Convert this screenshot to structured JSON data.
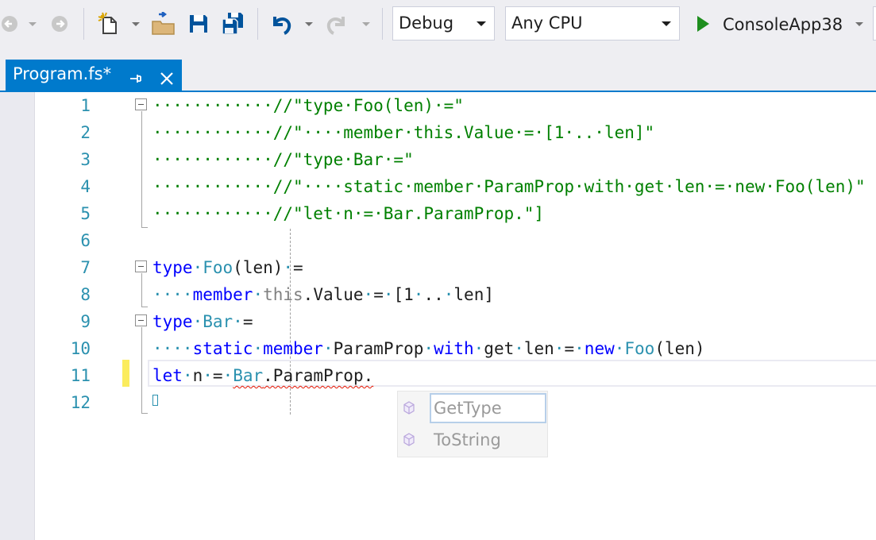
{
  "toolbar": {
    "configuration": "Debug",
    "platform": "Any CPU",
    "start_label": "ConsoleApp38",
    "icons": [
      "back-icon",
      "forward-icon",
      "new-project-icon",
      "open-folder-icon",
      "save-icon",
      "save-all-icon",
      "undo-icon",
      "redo-icon",
      "run-icon"
    ]
  },
  "tab": {
    "title": "Program.fs*",
    "pin_glyph": "⊣",
    "close_glyph": "✕"
  },
  "editor": {
    "line_numbers": [
      "1",
      "2",
      "3",
      "4",
      "5",
      "6",
      "7",
      "8",
      "9",
      "10",
      "11",
      "12"
    ],
    "lines": [
      [
        [
          "cm",
          "············//\"type·Foo(len)·=\""
        ]
      ],
      [
        [
          "cm",
          "············//\"····member·this.Value·=·[1·..·len]\""
        ]
      ],
      [
        [
          "cm",
          "············//\"type·Bar·=\""
        ]
      ],
      [
        [
          "cm",
          "············//\"····static·member·ParamProp·with·get·len·=·new·Foo(len)\""
        ]
      ],
      [
        [
          "cm",
          "············//\"let·n·=·Bar.ParamProp.\"]"
        ]
      ],
      [],
      [
        [
          "kw",
          "type"
        ],
        [
          "ty",
          "·"
        ],
        [
          "ty",
          "Foo"
        ],
        [
          "tx",
          "(len)"
        ],
        [
          "ty",
          "·"
        ],
        [
          "tx",
          "="
        ]
      ],
      [
        [
          "ty",
          "····"
        ],
        [
          "kw",
          "member"
        ],
        [
          "ty",
          "·"
        ],
        [
          "gy",
          "this"
        ],
        [
          "tx",
          ".Value"
        ],
        [
          "ty",
          "·"
        ],
        [
          "tx",
          "="
        ],
        [
          "ty",
          "·"
        ],
        [
          "tx",
          "[1"
        ],
        [
          "ty",
          "·"
        ],
        [
          "tx",
          ".."
        ],
        [
          "ty",
          "·"
        ],
        [
          "tx",
          "len]"
        ]
      ],
      [
        [
          "kw",
          "type"
        ],
        [
          "ty",
          "·"
        ],
        [
          "ty",
          "Bar"
        ],
        [
          "ty",
          "·"
        ],
        [
          "tx",
          "="
        ]
      ],
      [
        [
          "ty",
          "····"
        ],
        [
          "kw",
          "static"
        ],
        [
          "ty",
          "·"
        ],
        [
          "kw",
          "member"
        ],
        [
          "ty",
          "·"
        ],
        [
          "tx",
          "ParamProp"
        ],
        [
          "ty",
          "·"
        ],
        [
          "kw",
          "with"
        ],
        [
          "ty",
          "·"
        ],
        [
          "tx",
          "get"
        ],
        [
          "ty",
          "·"
        ],
        [
          "tx",
          "len"
        ],
        [
          "ty",
          "·"
        ],
        [
          "tx",
          "="
        ],
        [
          "ty",
          "·"
        ],
        [
          "kw",
          "new"
        ],
        [
          "ty",
          "·"
        ],
        [
          "ty",
          "Foo"
        ],
        [
          "tx",
          "(len)"
        ]
      ],
      [
        [
          "kw",
          "let"
        ],
        [
          "ty",
          "·"
        ],
        [
          "tx",
          "n"
        ],
        [
          "ty",
          "·"
        ],
        [
          "tx",
          "="
        ],
        [
          "ty",
          "·"
        ],
        [
          "ty sq",
          "Bar"
        ],
        [
          "tx sq",
          ".ParamProp."
        ]
      ],
      []
    ]
  },
  "completion": {
    "items": [
      {
        "label": "GetType",
        "icon": "method-cube-icon",
        "selected": true
      },
      {
        "label": "ToString",
        "icon": "method-cube-icon",
        "selected": false
      }
    ]
  }
}
